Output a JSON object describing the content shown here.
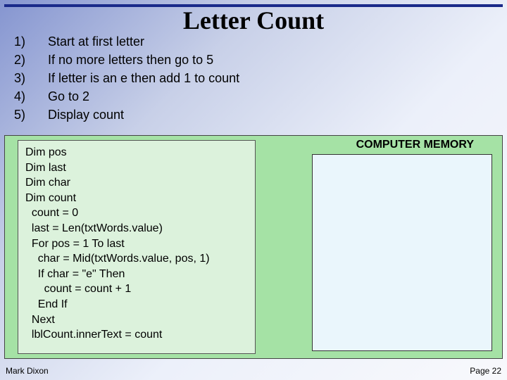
{
  "title": "Letter Count",
  "steps": [
    {
      "num": "1)",
      "text": "Start at first letter"
    },
    {
      "num": "2)",
      "text": "If no more letters then go to 5"
    },
    {
      "num": "3)",
      "text": "If letter is an e then add 1 to count"
    },
    {
      "num": "4)",
      "text": "Go to 2"
    },
    {
      "num": "5)",
      "text": "Display count"
    }
  ],
  "code_lines": [
    "Dim pos",
    "Dim last",
    "Dim char",
    "Dim count",
    "  count = 0",
    "  last = Len(txtWords.value)",
    "  For pos = 1 To last",
    "    char = Mid(txtWords.value, pos, 1)",
    "    If char = \"e\" Then",
    "      count = count + 1",
    "    End If",
    "  Next",
    "  lblCount.innerText = count"
  ],
  "memory_title": "COMPUTER MEMORY",
  "footer": {
    "left": "Mark Dixon",
    "right": "Page 22"
  }
}
